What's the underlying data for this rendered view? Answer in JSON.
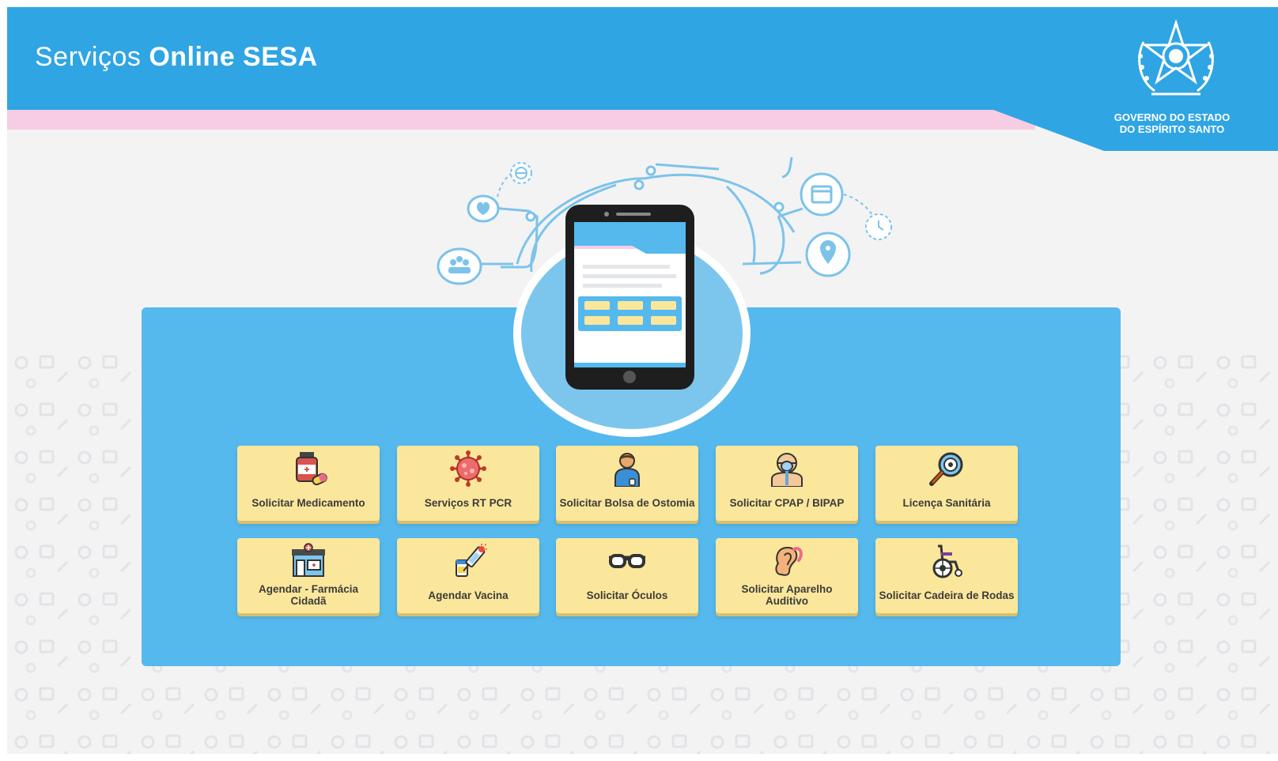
{
  "header": {
    "title_light": "Serviços",
    "title_bold": "Online SESA",
    "logo_text_line1": "GOVERNO DO ESTADO",
    "logo_text_line2": "DO ESPÍRITO SANTO"
  },
  "colors": {
    "header_blue": "#2fa5e4",
    "stripe_pink": "#f7cde4",
    "panel_blue": "#55b9ee",
    "tile_yellow": "#fbe79b"
  },
  "services": [
    {
      "label": "Solicitar Medicamento",
      "icon": "medicine-icon"
    },
    {
      "label": "Serviços RT PCR",
      "icon": "virus-icon"
    },
    {
      "label": "Solicitar Bolsa de Ostomia",
      "icon": "patient-icon"
    },
    {
      "label": "Solicitar CPAP / BIPAP",
      "icon": "cpap-mask-icon"
    },
    {
      "label": "Licença Sanitária",
      "icon": "magnifier-inspection-icon"
    },
    {
      "label": "Agendar - Farmácia Cidadã",
      "icon": "pharmacy-icon"
    },
    {
      "label": "Agendar Vacina",
      "icon": "vaccine-icon"
    },
    {
      "label": "Solicitar Óculos",
      "icon": "glasses-icon"
    },
    {
      "label": "Solicitar Aparelho Auditivo",
      "icon": "hearing-aid-icon"
    },
    {
      "label": "Solicitar Cadeira de Rodas",
      "icon": "wheelchair-icon"
    }
  ]
}
